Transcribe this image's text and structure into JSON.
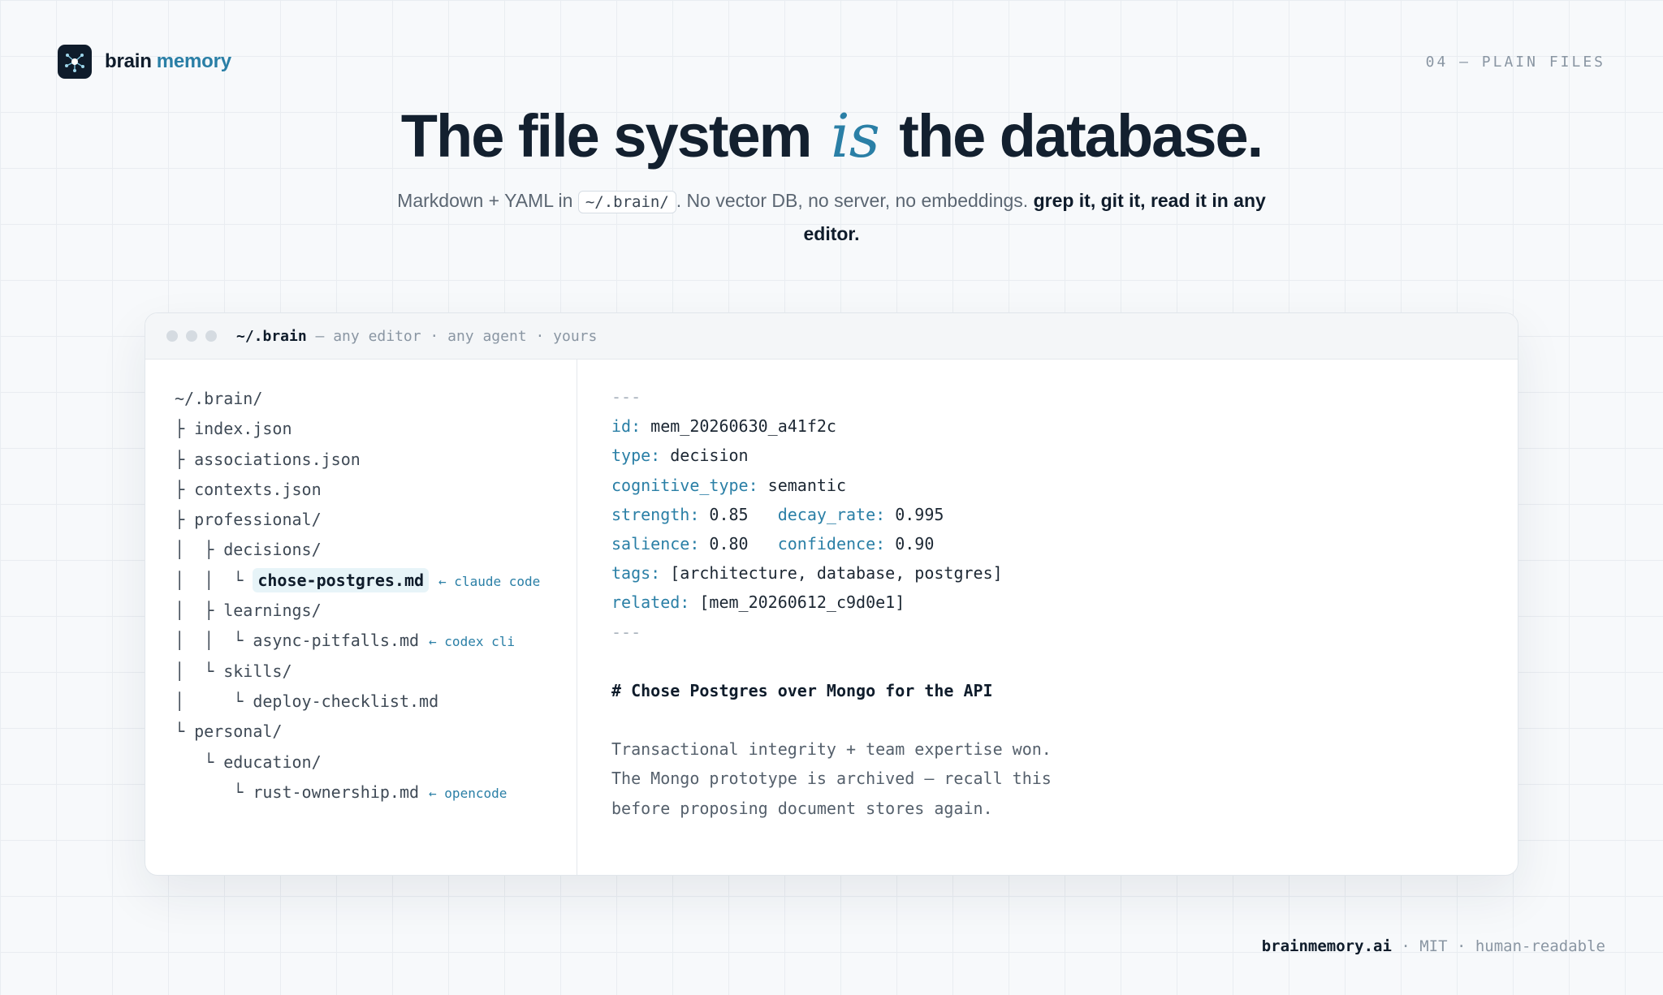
{
  "brand": {
    "name_part1": "brain",
    "name_part2": "memory",
    "logo_icon": "brain-network-icon"
  },
  "section_tag": "04 — PLAIN FILES",
  "headline": {
    "part1": "The file system",
    "emphasis": "is",
    "part2": "the database."
  },
  "subtitle": {
    "lead": "Markdown + YAML in",
    "path_chip": "~/.brain/",
    "middle": ". No vector DB, no server, no embeddings.",
    "strong": "grep it, git it, read it in any editor."
  },
  "window": {
    "path": "~/.brain",
    "tagline": "— any editor · any agent · yours",
    "tree": [
      {
        "prefix": "",
        "name": "~/.brain/"
      },
      {
        "prefix": "├ ",
        "name": "index.json"
      },
      {
        "prefix": "├ ",
        "name": "associations.json"
      },
      {
        "prefix": "├ ",
        "name": "contexts.json"
      },
      {
        "prefix": "├ ",
        "name": "professional/"
      },
      {
        "prefix": "│  ├ ",
        "name": "decisions/"
      },
      {
        "prefix": "│  │  └ ",
        "name": "chose-postgres.md",
        "origin": "← claude code"
      },
      {
        "prefix": "│  ├ ",
        "name": "learnings/"
      },
      {
        "prefix": "│  │  └ ",
        "name": "async-pitfalls.md",
        "origin": "← codex cli"
      },
      {
        "prefix": "│  └ ",
        "name": "skills/"
      },
      {
        "prefix": "│     └ ",
        "name": "deploy-checklist.md"
      },
      {
        "prefix": "└ ",
        "name": "personal/"
      },
      {
        "prefix": "   └ ",
        "name": "education/"
      },
      {
        "prefix": "      └ ",
        "name": "rust-ownership.md",
        "origin": "← opencode"
      }
    ],
    "file": {
      "separator": "---",
      "id_key": "id:",
      "id_val": "mem_20260630_a41f2c",
      "type_key": "type:",
      "type_val": "decision",
      "cognitive_key": "cognitive_type:",
      "cognitive_val": "semantic",
      "strength_key": "strength:",
      "strength_val": "0.85",
      "decay_key": "decay_rate:",
      "decay_val": "0.995",
      "salience_key": "salience:",
      "salience_val": "0.80",
      "confidence_key": "confidence:",
      "confidence_val": "0.90",
      "tags_key": "tags:",
      "tags_val": "[architecture, database, postgres]",
      "related_key": "related:",
      "related_val": "[mem_20260612_c9d0e1]",
      "heading": "# Chose Postgres over Mongo for the API",
      "body_1": "Transactional integrity + team expertise won.",
      "body_2": "The Mongo prototype is archived — recall this",
      "body_3": "before proposing document stores again."
    }
  },
  "footer": {
    "site": "brainmemory.ai",
    "rest": " · MIT · human-readable"
  }
}
